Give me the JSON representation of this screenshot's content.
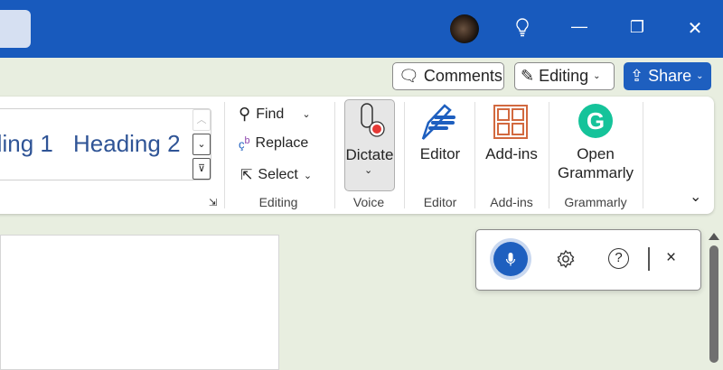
{
  "titlebar": {
    "lightbulb_icon": "lightbulb-icon",
    "minimize": "—",
    "restore": "❐",
    "close": "✕"
  },
  "actions": {
    "comments": "Comments",
    "editing": "Editing",
    "share": "Share"
  },
  "styles": {
    "heading1_partial": "ding 1",
    "heading2": "Heading 2"
  },
  "editing": {
    "find": "Find",
    "replace": "Replace",
    "select": "Select",
    "group": "Editing"
  },
  "voice": {
    "dictate": "Dictate",
    "group": "Voice"
  },
  "editor": {
    "label": "Editor",
    "group": "Editor"
  },
  "addins": {
    "label": "Add-ins",
    "group": "Add-ins"
  },
  "grammarly": {
    "label1": "Open",
    "label2": "Grammarly",
    "group": "Grammarly"
  },
  "dictation_toolbar": {
    "close": "×"
  },
  "colors": {
    "titlebar": "#185abd",
    "accent": "#1e5fbf",
    "grammarly": "#15c39a",
    "record": "#e53935"
  }
}
